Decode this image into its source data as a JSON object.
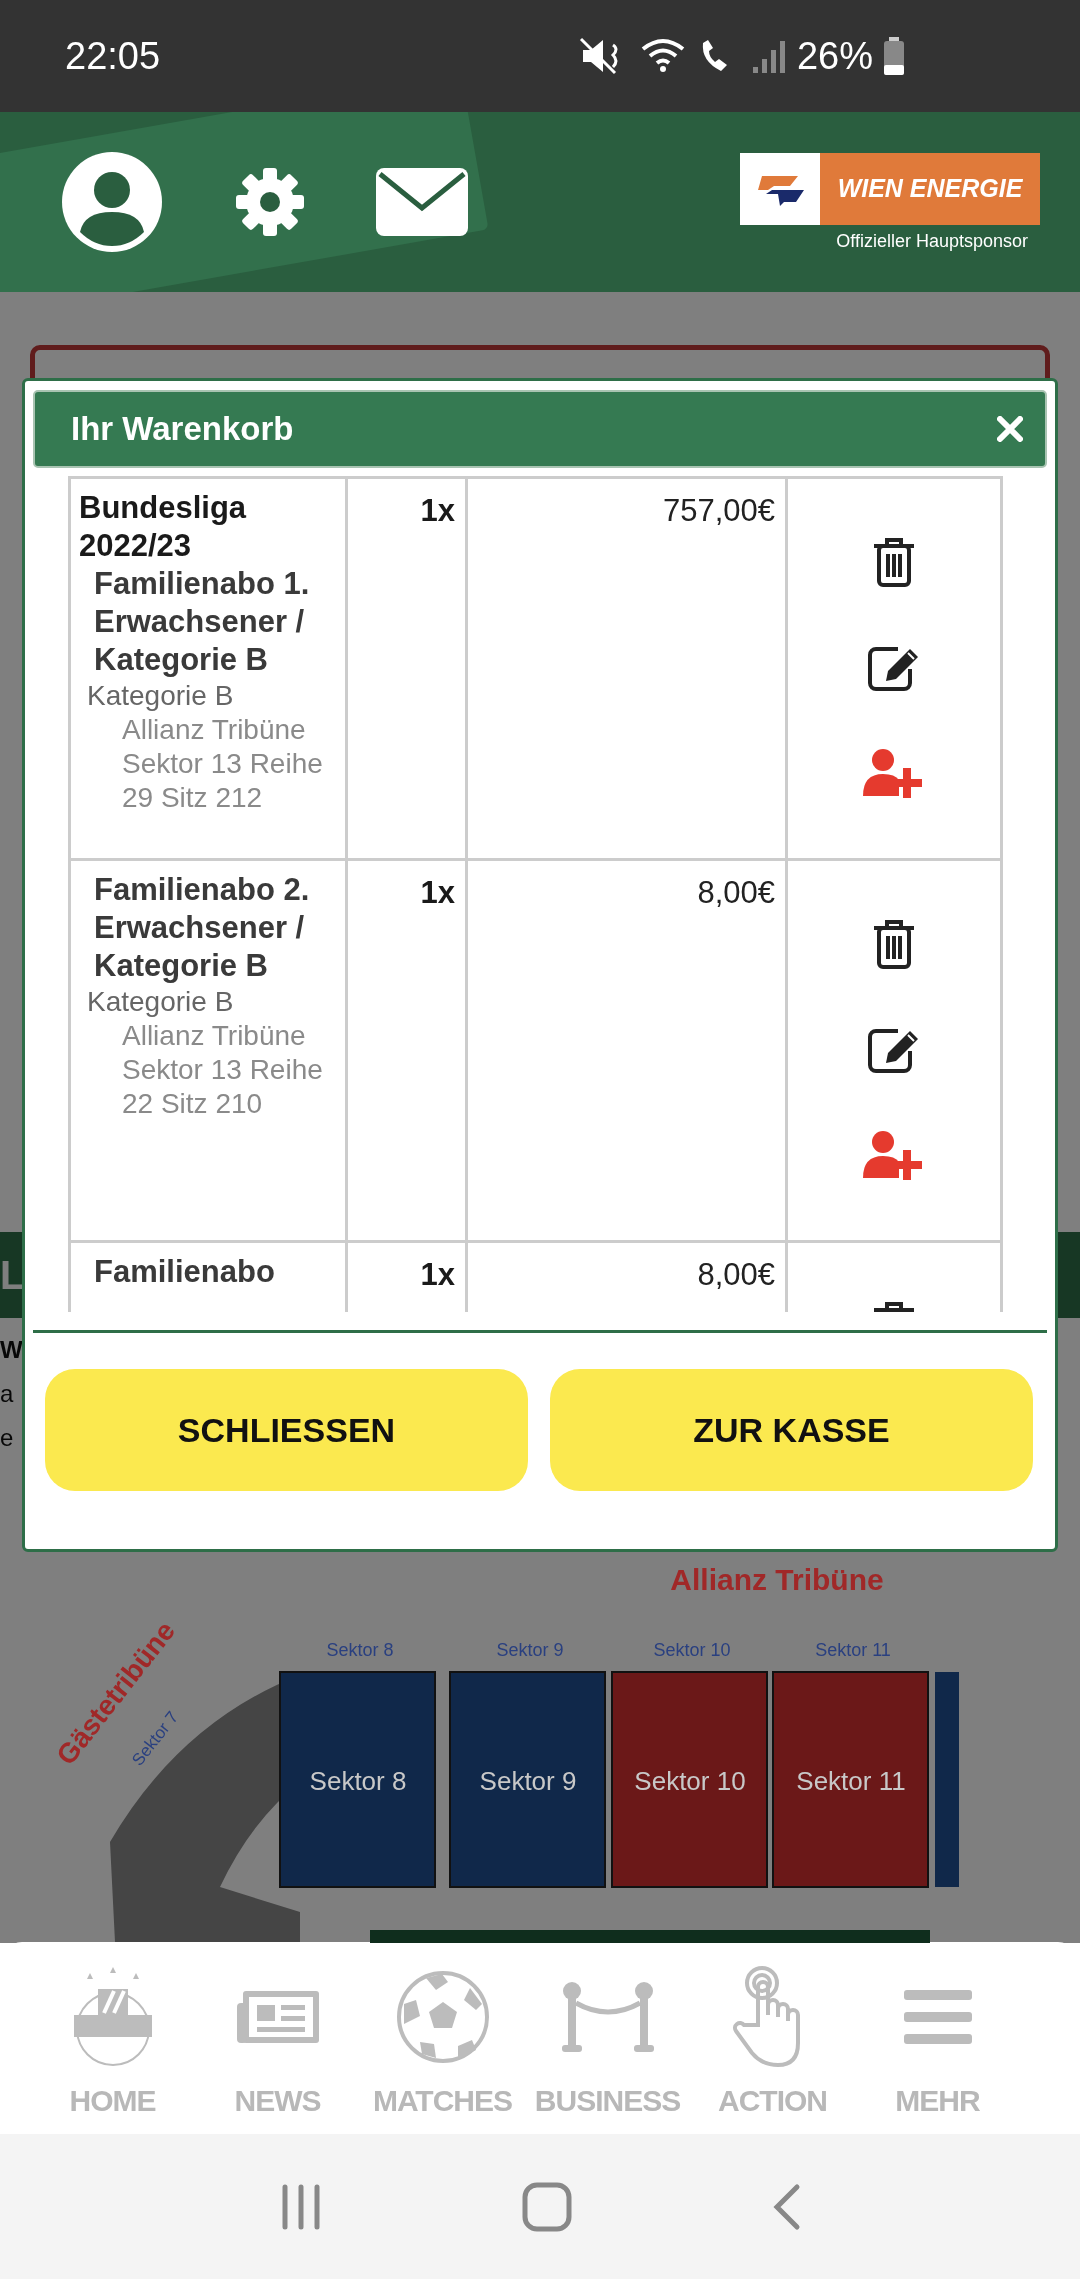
{
  "status_bar": {
    "time": "22:05",
    "battery": "26%"
  },
  "header": {
    "sponsor": {
      "name": "WIEN ENERGIE",
      "caption": "Offizieller Hauptsponsor"
    }
  },
  "background": {
    "band_text": "L",
    "fragments": [
      "W",
      "a",
      "e"
    ],
    "stadium": {
      "stand": "Allianz Tribüne",
      "away_stand": "Gästetribüne",
      "away_sector": "Sektor 7",
      "sectors": [
        {
          "heading": "Sektor 8",
          "label": "Sektor 8",
          "color": "#10284a"
        },
        {
          "heading": "Sektor 9",
          "label": "Sektor 9",
          "color": "#10284a"
        },
        {
          "heading": "Sektor 10",
          "label": "Sektor 10",
          "color": "#6b1818"
        },
        {
          "heading": "Sektor 11",
          "label": "Sektor 11",
          "color": "#6b1818"
        }
      ]
    }
  },
  "cart": {
    "title": "Ihr Warenkorb",
    "items": [
      {
        "event": "Bundesliga 2022/23",
        "product": "Familienabo 1. Erwachsener / Kategorie B",
        "category": "Kategorie B",
        "seat": "Allianz Tribüne Sektor 13 Reihe 29 Sitz 212",
        "quantity": "1x",
        "price": "757,00€"
      },
      {
        "product": "Familienabo 2. Erwachsener / Kategorie B",
        "category": "Kategorie B",
        "seat": "Allianz Tribüne Sektor 13 Reihe 22 Sitz 210",
        "quantity": "1x",
        "price": "8,00€"
      },
      {
        "product": "Familienabo",
        "quantity": "1x",
        "price": "8,00€"
      }
    ],
    "buttons": [
      {
        "label": "SCHLIESSEN"
      },
      {
        "label": "ZUR KASSE"
      }
    ]
  },
  "nav": [
    {
      "label": "HOME"
    },
    {
      "label": "NEWS"
    },
    {
      "label": "MATCHES"
    },
    {
      "label": "BUSINESS"
    },
    {
      "label": "ACTION"
    },
    {
      "label": "MEHR"
    }
  ]
}
